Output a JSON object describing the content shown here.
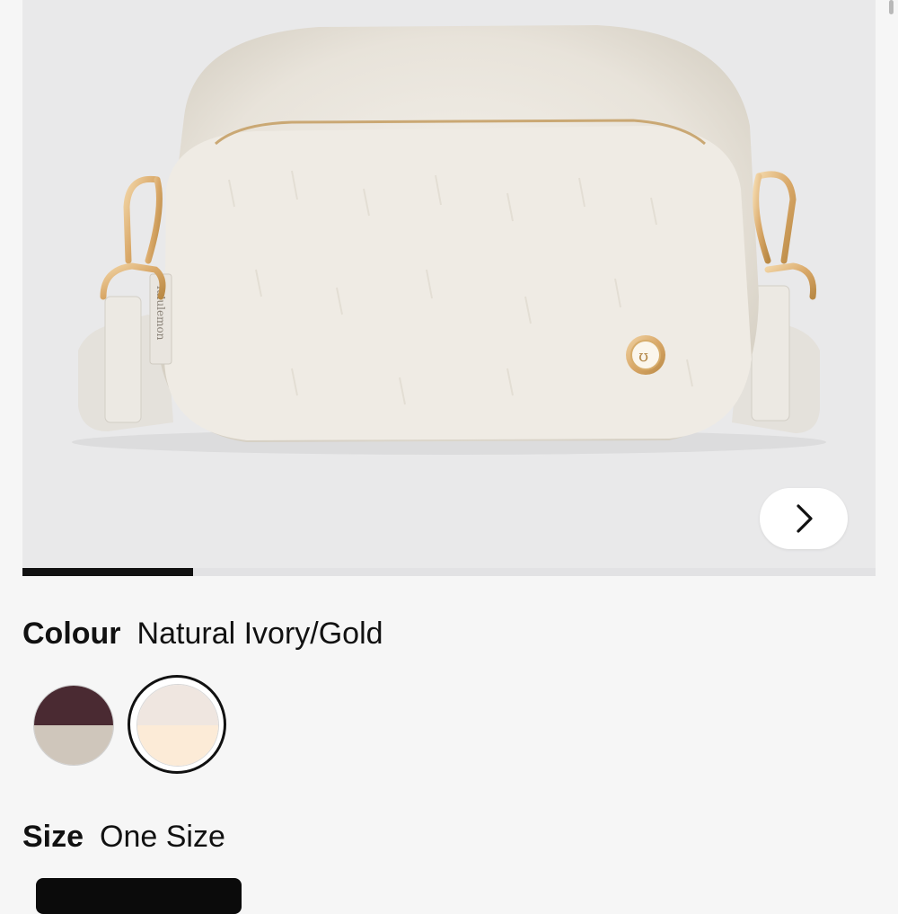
{
  "gallery": {
    "image_alt": "lululemon faux fur crossbody bag",
    "logo_text": "lululemon",
    "progress_fraction": 0.2,
    "next_icon": "chevron-right-icon"
  },
  "colour": {
    "label": "Colour",
    "value": "Natural Ivory/Gold",
    "swatches": [
      {
        "top": "#4a2a32",
        "bottom": "#cfc6bb",
        "selected": false
      },
      {
        "top": "#efe6e0",
        "bottom": "#fcebd7",
        "selected": true
      }
    ]
  },
  "size": {
    "label": "Size",
    "value": "One Size"
  }
}
